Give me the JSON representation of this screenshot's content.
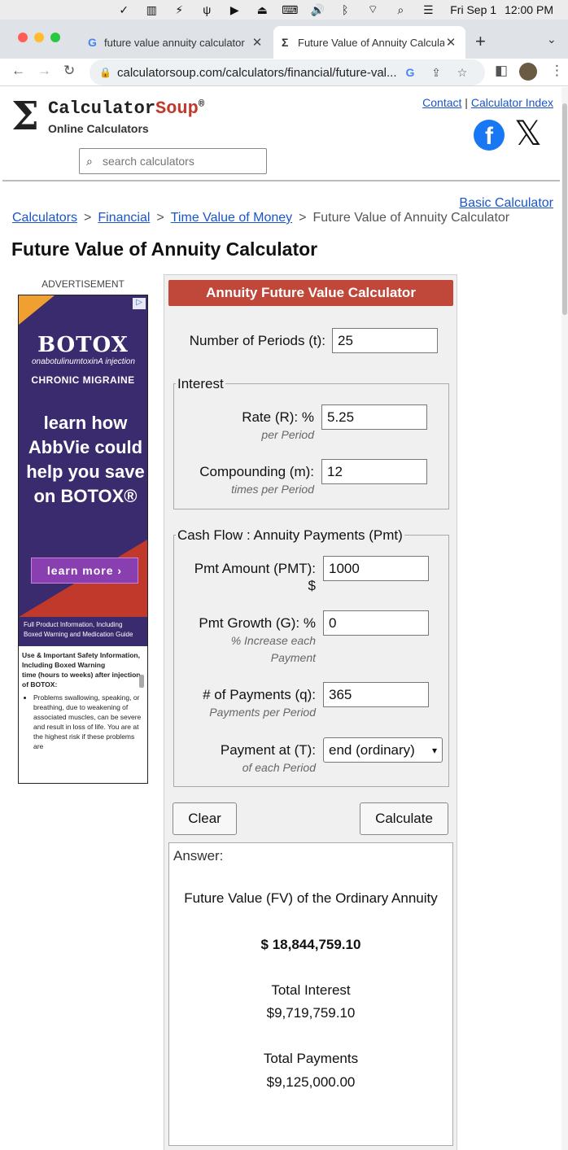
{
  "menubar": {
    "date": "Fri Sep 1",
    "time": "12:00 PM"
  },
  "tabs": [
    {
      "title": "future value annuity calculator",
      "favicon": "G"
    },
    {
      "title": "Future Value of Annuity Calcula",
      "favicon": "Σ"
    }
  ],
  "toolbar": {
    "url": "calculatorsoup.com/calculators/financial/future-val..."
  },
  "site": {
    "logo_sigma": "Σ",
    "logo_name_part1": "Calculator",
    "logo_name_part2": "Soup",
    "logo_reg": "®",
    "logo_sub": "Online Calculators",
    "contact_link": "Contact",
    "link_sep": "|",
    "index_link": "Calculator Index",
    "search_placeholder": "search calculators"
  },
  "breadcrumb": {
    "basic_link": "Basic Calculator",
    "items": [
      "Calculators",
      "Financial",
      "Time Value of Money"
    ],
    "current": "Future Value of Annuity Calculator",
    "separator": ">"
  },
  "page_title": "Future Value of Annuity Calculator",
  "ad": {
    "label": "ADVERTISEMENT",
    "brand": "BOTOX",
    "brand_sub": "onabotulinumtoxinA injection",
    "condition": "CHRONIC MIGRAINE",
    "headline": "learn how AbbVie could help you save on BOTOX®",
    "cta": "learn more  ›",
    "info": "Full Product Information, Including Boxed Warning and Medication Guide",
    "safety_title": "Use & Important Safety Information, Including Boxed Warning",
    "safety_text": "time (hours to weeks) after injection of BOTOX:",
    "safety_bullet": "Problems swallowing, speaking, or breathing, due to weakening of associated muscles, can be severe and result in loss of life. You are at the highest risk if these problems are"
  },
  "calculator": {
    "header": "Annuity Future Value Calculator",
    "periods_label": "Number of Periods (t):",
    "periods_value": "25",
    "interest_legend": "Interest",
    "rate_label": "Rate (R): %",
    "rate_sub": "per Period",
    "rate_value": "5.25",
    "compounding_label": "Compounding (m):",
    "compounding_sub": "times per Period",
    "compounding_value": "12",
    "cashflow_legend": "Cash Flow : Annuity Payments (Pmt)",
    "pmt_label": "Pmt Amount (PMT):",
    "pmt_unit": "$",
    "pmt_value": "1000",
    "growth_label": "Pmt Growth (G): %",
    "growth_sub1": "% Increase each",
    "growth_sub2": "Payment",
    "growth_value": "0",
    "payments_label": "# of Payments (q):",
    "payments_sub": "Payments per Period",
    "payments_value": "365",
    "payat_label": "Payment at (T):",
    "payat_sub": "of each Period",
    "payat_value": "end (ordinary)",
    "clear_button": "Clear",
    "calculate_button": "Calculate"
  },
  "answer": {
    "label": "Answer:",
    "fv_title": "Future Value (FV) of the Ordinary Annuity",
    "fv_value": "$ 18,844,759.10",
    "interest_title": "Total Interest",
    "interest_value": "$9,719,759.10",
    "payments_title": "Total Payments",
    "payments_value": "$9,125,000.00"
  }
}
